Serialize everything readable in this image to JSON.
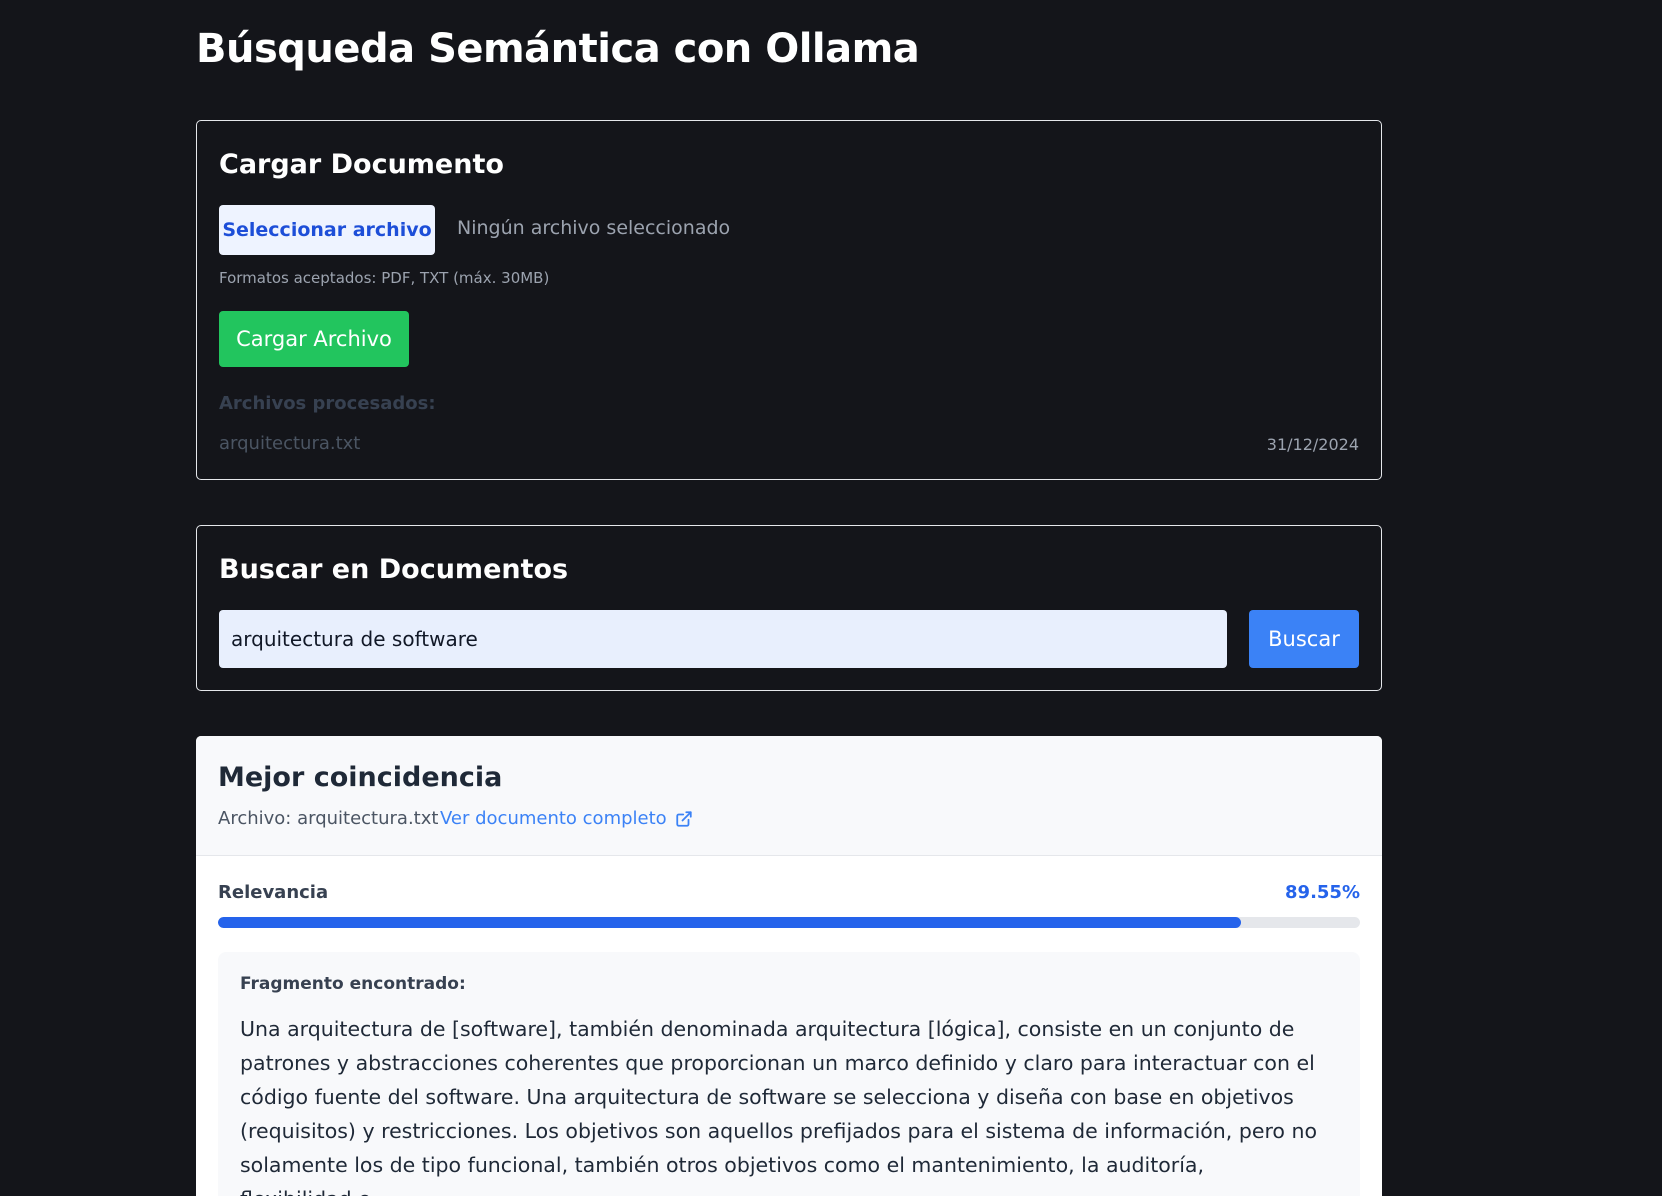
{
  "page": {
    "title": "Búsqueda Semántica con Ollama"
  },
  "upload": {
    "title": "Cargar Documento",
    "select_button": "Seleccionar archivo",
    "file_status": "Ningún archivo seleccionado",
    "formats_hint": "Formatos aceptados: PDF, TXT (máx. 30MB)",
    "upload_button": "Cargar Archivo",
    "processed_label": "Archivos procesados:",
    "processed_files": [
      {
        "name": "arquitectura.txt",
        "date": "31/12/2024"
      }
    ]
  },
  "search": {
    "title": "Buscar en Documentos",
    "query": "arquitectura de software",
    "button": "Buscar"
  },
  "result": {
    "title": "Mejor coincidencia",
    "file_label": "Archivo: arquitectura.txt",
    "link_label": "Ver documento completo",
    "link_icon": "external-link-icon",
    "relevance_label": "Relevancia",
    "relevance_value": "89.55%",
    "relevance_fraction": 0.8955,
    "fragment_label": "Fragmento encontrado:",
    "fragment_text": "Una arquitectura de [software], también denominada arquitectura [lógica], consiste en un conjunto de patrones y abstracciones coherentes que proporcionan un marco definido y claro para interactuar con el código fuente del software. Una arquitectura de software se selecciona y diseña con base en objetivos (requisitos) y restricciones. Los objetivos son aquellos prefijados para el sistema de información, pero no solamente los de tipo funcional, también otros objetivos como el mantenimiento, la auditoría, flexibilidad e"
  },
  "colors": {
    "background": "#14151a",
    "primary_blue": "#2563eb",
    "success_green": "#22c55e"
  }
}
